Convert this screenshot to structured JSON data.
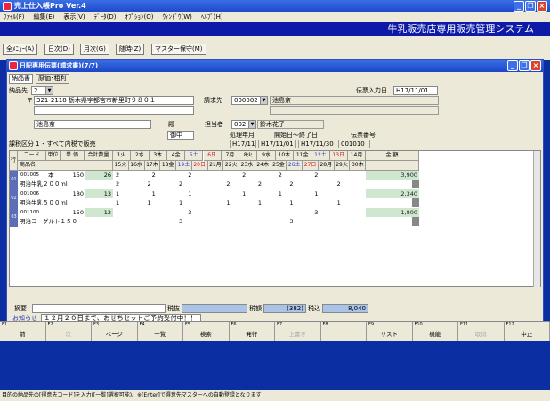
{
  "app": {
    "title": "売上仕入帳Pro Ver.4",
    "menu": [
      "ﾌｧｲﾙ(F)",
      "編集(E)",
      "表示(V)",
      "ﾃﾞｰﾀ(D)",
      "ｵﾌﾟｼｮﾝ(O)",
      "ｳｨﾝﾄﾞｳ(W)",
      "ﾍﾙﾌﾟ(H)"
    ],
    "banner": "牛乳販売店専用販売管理システム",
    "toolbar": [
      "全ﾒﾆｭｰ(A)",
      "日次(D)",
      "月次(G)",
      "随時(Z)",
      "マスター保守(M)"
    ],
    "status": "目的の納品先の[得意先コード]を入力([一覧]選択可能)。※[Enter]で得意先マスターへの自動登録となります"
  },
  "child": {
    "title": "日配専用伝票(請求書)(7/7)",
    "tabs": [
      "納品書",
      "原価･粗利"
    ]
  },
  "form": {
    "delivery_label": "納品先",
    "delivery_code": "2",
    "address": "321-2118 栃木県宇都宮市新里町９８０１",
    "zip_prefix": "〒",
    "name": "池島奈",
    "honorific": "殿",
    "kana": "御中",
    "entry_label": "伝票入力日",
    "entry_date": "H17/11/01",
    "bill_label": "請求先",
    "bill_code": "000002",
    "bill_name": "池島奈",
    "person_label": "担当者",
    "person_code": "002",
    "person_name": "鈴木花子",
    "period_label": "処理年月",
    "period_value": "H17/11",
    "range_label": "開始日〜終了日",
    "range_from": "H17/11/01",
    "range_to": "H17/11/30",
    "docno_label": "伝票番号",
    "docno_value": "001010",
    "tax_label": "課税区分",
    "tax_value": "1 ･ すべて内税で販売"
  },
  "grid": {
    "row_label": "行",
    "h_code": "コード",
    "h_unit": "単位",
    "h_price": "単 価",
    "h_qty": "合計数量",
    "h_name": "商品名",
    "h_amount": "金 額",
    "days_top": [
      "1火",
      "2水",
      "3木",
      "4金",
      "5土",
      "6日",
      "7月",
      "8火",
      "9水",
      "10木",
      "11金",
      "12土",
      "13日",
      "14月"
    ],
    "days_bot": [
      "15火",
      "16水",
      "17木",
      "18金",
      "19土",
      "20日",
      "21月",
      "22火",
      "23水",
      "24木",
      "25金",
      "26土",
      "27日",
      "28月",
      "29火",
      "30木"
    ],
    "rows": [
      {
        "no": "01",
        "code": "001005",
        "unit": "本",
        "price": "150",
        "qty": "26",
        "name": "明治牛乳２００ml",
        "top": [
          "2",
          "",
          "2",
          "",
          "2",
          "",
          "",
          "2",
          "",
          "2",
          "",
          "2",
          "",
          ""
        ],
        "bot": [
          "2",
          "",
          "2",
          "",
          "2",
          "",
          "",
          "2",
          "",
          "2",
          "",
          "2",
          "",
          "",
          "2",
          ""
        ],
        "amount": "3,900"
      },
      {
        "no": "02",
        "code": "001006",
        "unit": "",
        "price": "180",
        "qty": "13",
        "name": "明治牛乳５００ml",
        "top": [
          "1",
          "",
          "1",
          "",
          "1",
          "",
          "",
          "1",
          "",
          "1",
          "",
          "1",
          "",
          ""
        ],
        "bot": [
          "1",
          "",
          "1",
          "",
          "1",
          "",
          "",
          "1",
          "",
          "1",
          "",
          "1",
          "",
          "",
          "1",
          ""
        ],
        "amount": "2,340"
      },
      {
        "no": "03",
        "code": "001100",
        "unit": "",
        "price": "150",
        "qty": "12",
        "name": "明治ヨーグルト１５０",
        "top": [
          "",
          "",
          "",
          "",
          "3",
          "",
          "",
          "",
          "",
          "",
          "",
          "3",
          "",
          ""
        ],
        "bot": [
          "",
          "",
          "",
          "",
          "3",
          "",
          "",
          "",
          "",
          "",
          "",
          "3",
          "",
          "",
          "",
          ""
        ],
        "amount": "1,800"
      }
    ]
  },
  "footer": {
    "memo_label": "摘要",
    "tax_label": "税抜",
    "taxamt_label": "税額",
    "taxamt": "(382)",
    "incl_label": "税込",
    "incl": "8,040",
    "notice_label": "お知らせ",
    "notice": "１２月２０日まで、おせちセットご予約受付中！！"
  },
  "fkeys": [
    {
      "n": "F1",
      "l": "前"
    },
    {
      "n": "F2",
      "l": "次"
    },
    {
      "n": "F3",
      "l": "ページ"
    },
    {
      "n": "F4",
      "l": "一覧"
    },
    {
      "n": "F5",
      "l": "検索"
    },
    {
      "n": "F6",
      "l": "発行"
    },
    {
      "n": "F7",
      "l": "上書き"
    },
    {
      "n": "F8",
      "l": ""
    },
    {
      "n": "F9",
      "l": "リスト"
    },
    {
      "n": "F10",
      "l": "機能"
    },
    {
      "n": "F11",
      "l": "取消"
    },
    {
      "n": "F12",
      "l": "中止"
    }
  ]
}
